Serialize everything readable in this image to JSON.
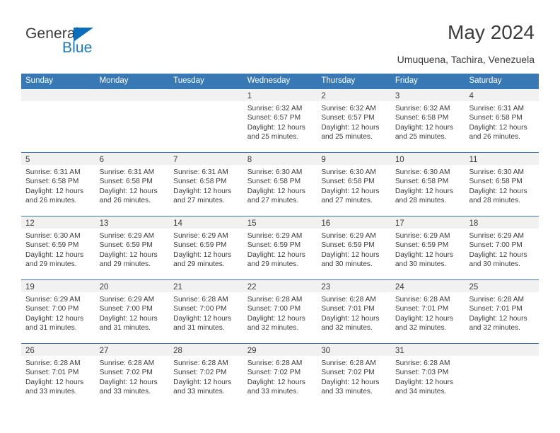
{
  "brand": {
    "name_part1": "General",
    "name_part2": "Blue",
    "triangle_color": "#0a6ebd",
    "blue_text_color": "#1878be"
  },
  "header": {
    "title": "May 2024",
    "subtitle": "Umuquena, Tachira, Venezuela"
  },
  "theme": {
    "header_blue": "#3878b4",
    "daynum_band": "#f1f1f1",
    "text": "#3c3c3c"
  },
  "weekdays": [
    "Sunday",
    "Monday",
    "Tuesday",
    "Wednesday",
    "Thursday",
    "Friday",
    "Saturday"
  ],
  "weeks": [
    [
      {
        "day": "",
        "sunrise": "",
        "sunset": "",
        "daylight1": "",
        "daylight2": "",
        "empty": true
      },
      {
        "day": "",
        "sunrise": "",
        "sunset": "",
        "daylight1": "",
        "daylight2": "",
        "empty": true
      },
      {
        "day": "",
        "sunrise": "",
        "sunset": "",
        "daylight1": "",
        "daylight2": "",
        "empty": true
      },
      {
        "day": "1",
        "sunrise": "Sunrise: 6:32 AM",
        "sunset": "Sunset: 6:57 PM",
        "daylight1": "Daylight: 12 hours",
        "daylight2": "and 25 minutes."
      },
      {
        "day": "2",
        "sunrise": "Sunrise: 6:32 AM",
        "sunset": "Sunset: 6:57 PM",
        "daylight1": "Daylight: 12 hours",
        "daylight2": "and 25 minutes."
      },
      {
        "day": "3",
        "sunrise": "Sunrise: 6:32 AM",
        "sunset": "Sunset: 6:58 PM",
        "daylight1": "Daylight: 12 hours",
        "daylight2": "and 25 minutes."
      },
      {
        "day": "4",
        "sunrise": "Sunrise: 6:31 AM",
        "sunset": "Sunset: 6:58 PM",
        "daylight1": "Daylight: 12 hours",
        "daylight2": "and 26 minutes."
      }
    ],
    [
      {
        "day": "5",
        "sunrise": "Sunrise: 6:31 AM",
        "sunset": "Sunset: 6:58 PM",
        "daylight1": "Daylight: 12 hours",
        "daylight2": "and 26 minutes."
      },
      {
        "day": "6",
        "sunrise": "Sunrise: 6:31 AM",
        "sunset": "Sunset: 6:58 PM",
        "daylight1": "Daylight: 12 hours",
        "daylight2": "and 26 minutes."
      },
      {
        "day": "7",
        "sunrise": "Sunrise: 6:31 AM",
        "sunset": "Sunset: 6:58 PM",
        "daylight1": "Daylight: 12 hours",
        "daylight2": "and 27 minutes."
      },
      {
        "day": "8",
        "sunrise": "Sunrise: 6:30 AM",
        "sunset": "Sunset: 6:58 PM",
        "daylight1": "Daylight: 12 hours",
        "daylight2": "and 27 minutes."
      },
      {
        "day": "9",
        "sunrise": "Sunrise: 6:30 AM",
        "sunset": "Sunset: 6:58 PM",
        "daylight1": "Daylight: 12 hours",
        "daylight2": "and 27 minutes."
      },
      {
        "day": "10",
        "sunrise": "Sunrise: 6:30 AM",
        "sunset": "Sunset: 6:58 PM",
        "daylight1": "Daylight: 12 hours",
        "daylight2": "and 28 minutes."
      },
      {
        "day": "11",
        "sunrise": "Sunrise: 6:30 AM",
        "sunset": "Sunset: 6:58 PM",
        "daylight1": "Daylight: 12 hours",
        "daylight2": "and 28 minutes."
      }
    ],
    [
      {
        "day": "12",
        "sunrise": "Sunrise: 6:30 AM",
        "sunset": "Sunset: 6:59 PM",
        "daylight1": "Daylight: 12 hours",
        "daylight2": "and 29 minutes."
      },
      {
        "day": "13",
        "sunrise": "Sunrise: 6:29 AM",
        "sunset": "Sunset: 6:59 PM",
        "daylight1": "Daylight: 12 hours",
        "daylight2": "and 29 minutes."
      },
      {
        "day": "14",
        "sunrise": "Sunrise: 6:29 AM",
        "sunset": "Sunset: 6:59 PM",
        "daylight1": "Daylight: 12 hours",
        "daylight2": "and 29 minutes."
      },
      {
        "day": "15",
        "sunrise": "Sunrise: 6:29 AM",
        "sunset": "Sunset: 6:59 PM",
        "daylight1": "Daylight: 12 hours",
        "daylight2": "and 29 minutes."
      },
      {
        "day": "16",
        "sunrise": "Sunrise: 6:29 AM",
        "sunset": "Sunset: 6:59 PM",
        "daylight1": "Daylight: 12 hours",
        "daylight2": "and 30 minutes."
      },
      {
        "day": "17",
        "sunrise": "Sunrise: 6:29 AM",
        "sunset": "Sunset: 6:59 PM",
        "daylight1": "Daylight: 12 hours",
        "daylight2": "and 30 minutes."
      },
      {
        "day": "18",
        "sunrise": "Sunrise: 6:29 AM",
        "sunset": "Sunset: 7:00 PM",
        "daylight1": "Daylight: 12 hours",
        "daylight2": "and 30 minutes."
      }
    ],
    [
      {
        "day": "19",
        "sunrise": "Sunrise: 6:29 AM",
        "sunset": "Sunset: 7:00 PM",
        "daylight1": "Daylight: 12 hours",
        "daylight2": "and 31 minutes."
      },
      {
        "day": "20",
        "sunrise": "Sunrise: 6:29 AM",
        "sunset": "Sunset: 7:00 PM",
        "daylight1": "Daylight: 12 hours",
        "daylight2": "and 31 minutes."
      },
      {
        "day": "21",
        "sunrise": "Sunrise: 6:28 AM",
        "sunset": "Sunset: 7:00 PM",
        "daylight1": "Daylight: 12 hours",
        "daylight2": "and 31 minutes."
      },
      {
        "day": "22",
        "sunrise": "Sunrise: 6:28 AM",
        "sunset": "Sunset: 7:00 PM",
        "daylight1": "Daylight: 12 hours",
        "daylight2": "and 32 minutes."
      },
      {
        "day": "23",
        "sunrise": "Sunrise: 6:28 AM",
        "sunset": "Sunset: 7:01 PM",
        "daylight1": "Daylight: 12 hours",
        "daylight2": "and 32 minutes."
      },
      {
        "day": "24",
        "sunrise": "Sunrise: 6:28 AM",
        "sunset": "Sunset: 7:01 PM",
        "daylight1": "Daylight: 12 hours",
        "daylight2": "and 32 minutes."
      },
      {
        "day": "25",
        "sunrise": "Sunrise: 6:28 AM",
        "sunset": "Sunset: 7:01 PM",
        "daylight1": "Daylight: 12 hours",
        "daylight2": "and 32 minutes."
      }
    ],
    [
      {
        "day": "26",
        "sunrise": "Sunrise: 6:28 AM",
        "sunset": "Sunset: 7:01 PM",
        "daylight1": "Daylight: 12 hours",
        "daylight2": "and 33 minutes."
      },
      {
        "day": "27",
        "sunrise": "Sunrise: 6:28 AM",
        "sunset": "Sunset: 7:02 PM",
        "daylight1": "Daylight: 12 hours",
        "daylight2": "and 33 minutes."
      },
      {
        "day": "28",
        "sunrise": "Sunrise: 6:28 AM",
        "sunset": "Sunset: 7:02 PM",
        "daylight1": "Daylight: 12 hours",
        "daylight2": "and 33 minutes."
      },
      {
        "day": "29",
        "sunrise": "Sunrise: 6:28 AM",
        "sunset": "Sunset: 7:02 PM",
        "daylight1": "Daylight: 12 hours",
        "daylight2": "and 33 minutes."
      },
      {
        "day": "30",
        "sunrise": "Sunrise: 6:28 AM",
        "sunset": "Sunset: 7:02 PM",
        "daylight1": "Daylight: 12 hours",
        "daylight2": "and 33 minutes."
      },
      {
        "day": "31",
        "sunrise": "Sunrise: 6:28 AM",
        "sunset": "Sunset: 7:03 PM",
        "daylight1": "Daylight: 12 hours",
        "daylight2": "and 34 minutes."
      },
      {
        "day": "",
        "sunrise": "",
        "sunset": "",
        "daylight1": "",
        "daylight2": "",
        "empty": true
      }
    ]
  ]
}
